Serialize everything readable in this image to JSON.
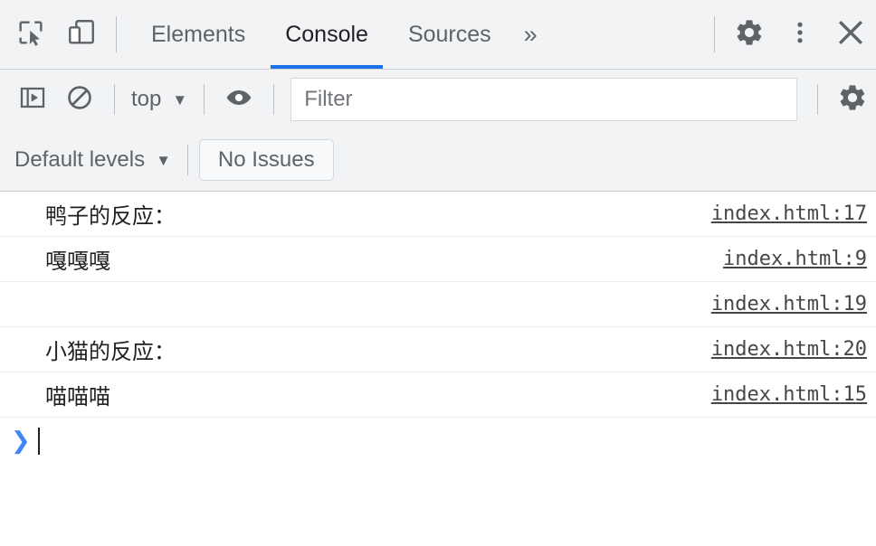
{
  "tabbar": {
    "inspect_icon": "inspect-element-icon",
    "device_icon": "device-toolbar-icon",
    "tabs": [
      {
        "label": "Elements",
        "active": false
      },
      {
        "label": "Console",
        "active": true
      },
      {
        "label": "Sources",
        "active": false
      }
    ],
    "more_tabs_label": "»",
    "settings_icon": "gear-icon",
    "menu_icon": "three-dot-menu-icon",
    "close_icon": "close-icon"
  },
  "toolbar": {
    "sidebar_toggle_icon": "console-sidebar-icon",
    "clear_icon": "clear-console-icon",
    "context_label": "top",
    "eye_icon": "live-expression-eye-icon",
    "filter_placeholder": "Filter",
    "settings_icon": "gear-icon",
    "levels_label": "Default levels",
    "issues_label": "No Issues",
    "caret_glyph": "▼"
  },
  "console": {
    "messages": [
      {
        "text": "鸭子的反应：",
        "source": "index.html:17"
      },
      {
        "text": "嘎嘎嘎",
        "source": "index.html:9"
      },
      {
        "text": "",
        "source": "index.html:19"
      },
      {
        "text": "小猫的反应：",
        "source": "index.html:20"
      },
      {
        "text": "喵喵喵",
        "source": "index.html:15"
      }
    ],
    "prompt_chevron": "❯",
    "prompt_value": ""
  },
  "colors": {
    "accent": "#1a73e8",
    "prompt": "#4285f4",
    "toolbar_bg": "#f1f3f4",
    "text": "#202124",
    "muted": "#5f6368"
  }
}
